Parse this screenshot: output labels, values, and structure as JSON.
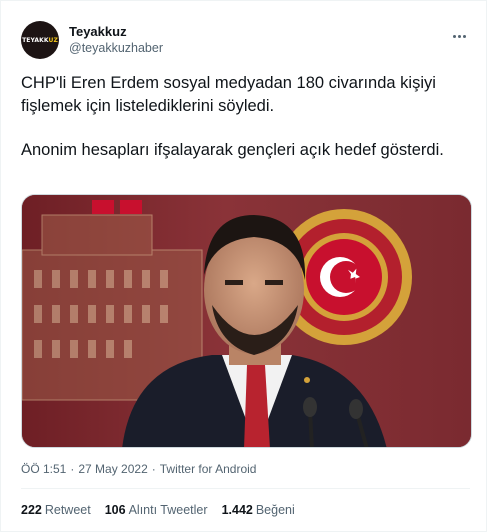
{
  "author": {
    "display_name": "Teyakkuz",
    "handle": "@teyakkuzhaber",
    "avatar_logo_a": "TEYAKK",
    "avatar_logo_b": "UZ"
  },
  "tweet": {
    "paragraph_1": "CHP'li Eren Erdem sosyal medyadan 180 civarında kişiyi fişlemek için listelediklerini söyledi.",
    "paragraph_2": "Anonim hesapları ifşalayarak gençleri açık hedef gösterdi."
  },
  "meta": {
    "time": "ÖÖ 1:51",
    "separator": "·",
    "date": "27 May 2022",
    "source": "Twitter for Android"
  },
  "stats": {
    "retweets_count": "222",
    "retweets_label": "Retweet",
    "quotes_count": "106",
    "quotes_label": "Alıntı Tweetler",
    "likes_count": "1.442",
    "likes_label": "Beğeni"
  },
  "colors": {
    "text_primary": "#0f1419",
    "text_secondary": "#536471",
    "border": "#eff3f4",
    "media_background": "#7a2a30",
    "emblem_red": "#c8102e",
    "emblem_gold": "#d4a23a"
  },
  "icons": {
    "more": "more-icon"
  }
}
